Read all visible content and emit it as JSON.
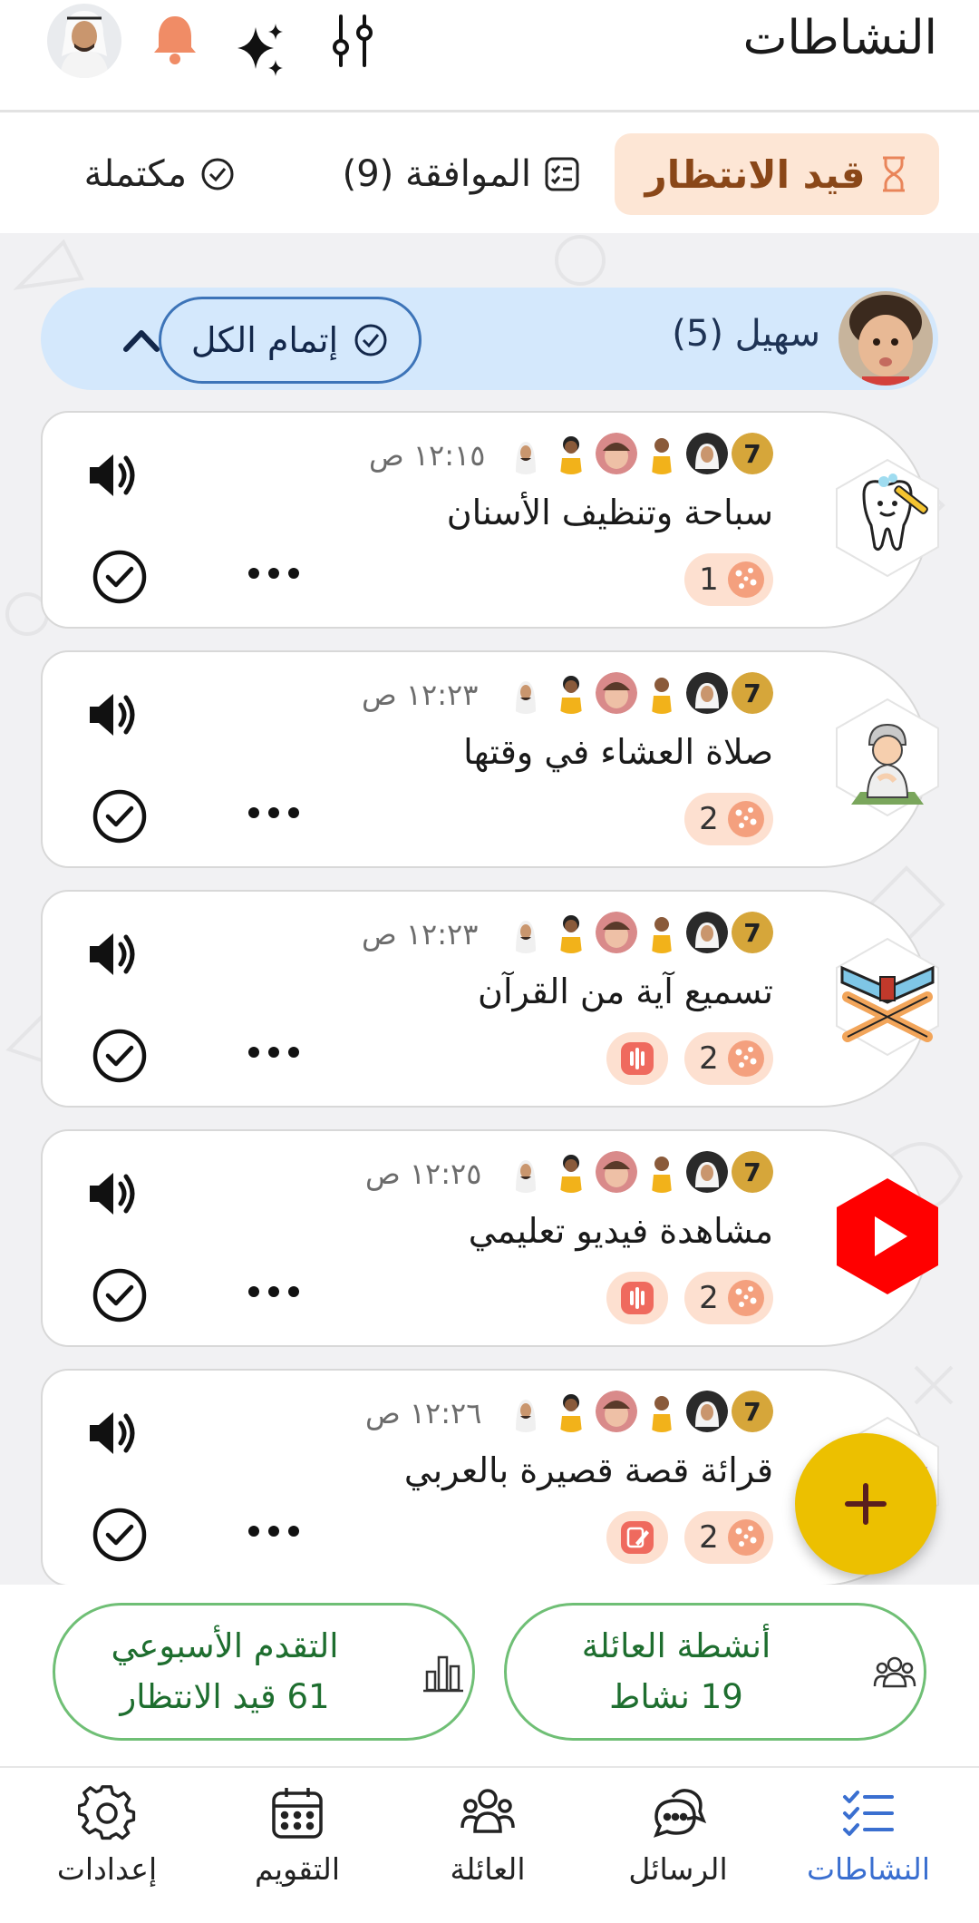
{
  "header": {
    "title": "النشاطات",
    "icons": [
      "filter-sliders-icon",
      "sparkles-icon",
      "bell-icon"
    ]
  },
  "tabs": [
    {
      "label": "قيد الانتظار",
      "icon": "hourglass-icon",
      "active": true
    },
    {
      "label": "الموافقة (9)",
      "icon": "checklist-icon",
      "active": false
    },
    {
      "label": "مكتملة",
      "icon": "check-circle-icon",
      "active": false
    }
  ],
  "group": {
    "name": "سهيل (5)",
    "complete_all_label": "إتمام الكل"
  },
  "activities": [
    {
      "title": "سباحة وتنظيف الأسنان",
      "time": "١٢:١٥ ص",
      "points": "1",
      "tag": null,
      "image": "tooth-brush-icon"
    },
    {
      "title": "صلاة العشاء في وقتها",
      "time": "١٢:٢٣ ص",
      "points": "2",
      "tag": null,
      "image": "praying-child-icon"
    },
    {
      "title": "تسميع آية من القرآن",
      "time": "١٢:٢٣ ص",
      "points": "2",
      "tag": "audio",
      "image": "quran-stand-icon"
    },
    {
      "title": "مشاهدة فيديو تعليمي",
      "time": "١٢:٢٥ ص",
      "points": "2",
      "tag": "audio",
      "image": "youtube-icon"
    },
    {
      "title": "قرائة قصة قصيرة بالعربي",
      "time": "١٢:٢٦ ص",
      "points": "2",
      "tag": "edit",
      "image": "story-icon"
    }
  ],
  "summary": {
    "family": {
      "line1": "أنشطة العائلة",
      "line2": "19 نشاط"
    },
    "progress": {
      "line1": "التقدم الأسبوعي",
      "line2": "61 قيد الانتظار"
    }
  },
  "nav": [
    {
      "label": "النشاطات",
      "icon": "activities-list-icon",
      "active": true
    },
    {
      "label": "الرسائل",
      "icon": "chat-bubbles-icon",
      "active": false
    },
    {
      "label": "العائلة",
      "icon": "family-icon",
      "active": false
    },
    {
      "label": "التقويم",
      "icon": "calendar-icon",
      "active": false
    },
    {
      "label": "إعدادات",
      "icon": "settings-gear-icon",
      "active": false
    }
  ],
  "colors": {
    "pending_tab_bg": "#fde6d5",
    "group_bar_bg": "#d4e8fc",
    "fab": "#ecc000",
    "accent_blue": "#3a6fd0",
    "summary_green": "#1e6e2f"
  }
}
